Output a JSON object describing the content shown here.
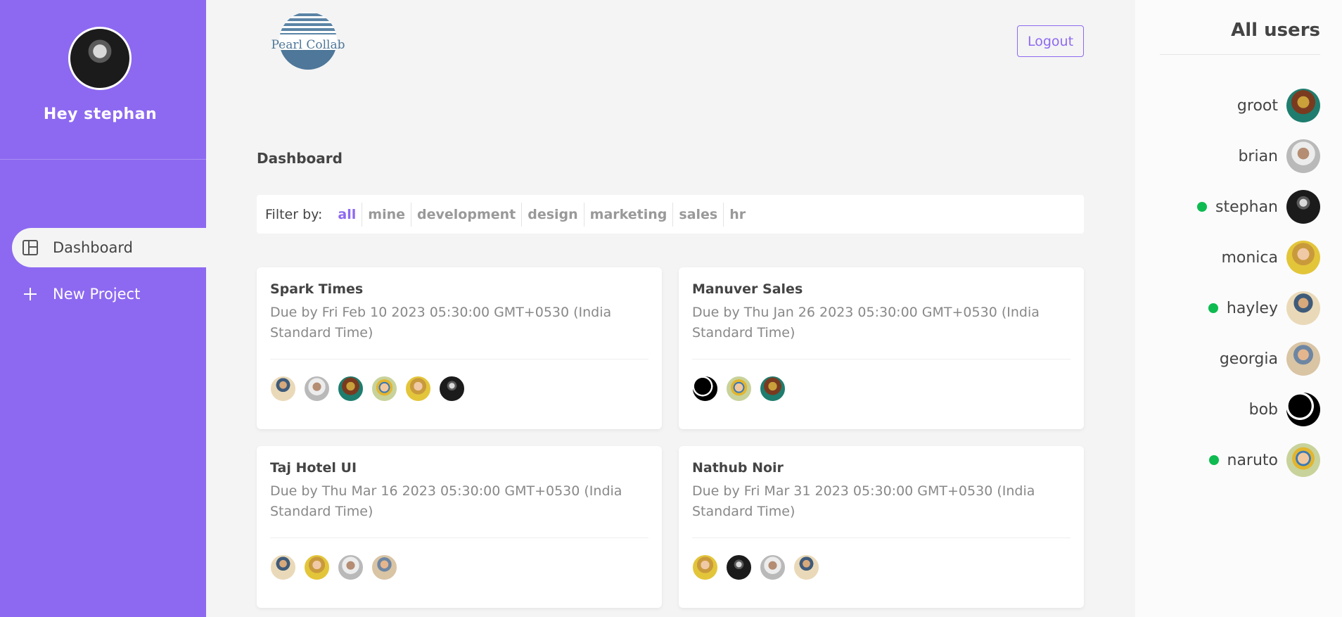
{
  "sidebar": {
    "greeting": "Hey stephan",
    "nav": [
      {
        "label": "Dashboard",
        "icon": "dashboard-icon",
        "active": true
      },
      {
        "label": "New Project",
        "icon": "plus-icon",
        "active": false
      }
    ]
  },
  "header": {
    "logo_text": "Pearl Collab",
    "logout_label": "Logout"
  },
  "main": {
    "title": "Dashboard",
    "filter_label": "Filter by:",
    "filters": [
      "all",
      "mine",
      "development",
      "design",
      "marketing",
      "sales",
      "hr"
    ],
    "active_filter": "all",
    "projects": [
      {
        "name": "Spark Times",
        "due": "Due by Fri Feb 10 2023 05:30:00 GMT+0530 (India Standard Time)",
        "assignees": [
          "hayley",
          "brian",
          "groot",
          "naruto",
          "monica",
          "stephan"
        ]
      },
      {
        "name": "Manuver Sales",
        "due": "Due by Thu Jan 26 2023 05:30:00 GMT+0530 (India Standard Time)",
        "assignees": [
          "bob",
          "naruto",
          "groot"
        ]
      },
      {
        "name": "Taj Hotel UI",
        "due": "Due by Thu Mar 16 2023 05:30:00 GMT+0530 (India Standard Time)",
        "assignees": [
          "hayley",
          "monica",
          "brian",
          "georgia"
        ]
      },
      {
        "name": "Nathub Noir",
        "due": "Due by Fri Mar 31 2023 05:30:00 GMT+0530 (India Standard Time)",
        "assignees": [
          "monica",
          "stephan",
          "brian",
          "hayley"
        ]
      }
    ]
  },
  "users": {
    "title": "All users",
    "list": [
      {
        "name": "groot",
        "online": false
      },
      {
        "name": "brian",
        "online": false
      },
      {
        "name": "stephan",
        "online": true
      },
      {
        "name": "monica",
        "online": false
      },
      {
        "name": "hayley",
        "online": true
      },
      {
        "name": "georgia",
        "online": false
      },
      {
        "name": "bob",
        "online": false
      },
      {
        "name": "naruto",
        "online": true
      }
    ]
  },
  "colors": {
    "accent": "#8d69f1",
    "online": "#0ebb50",
    "background": "#f4f4f4"
  }
}
